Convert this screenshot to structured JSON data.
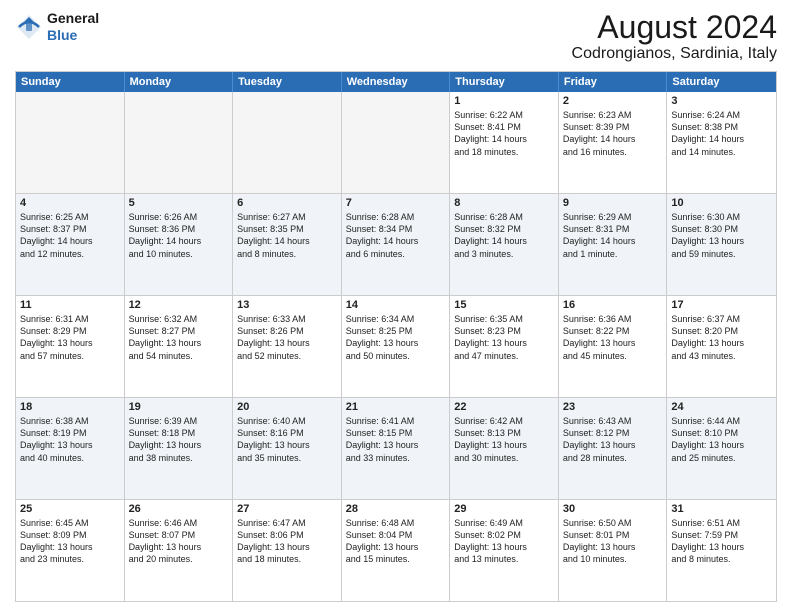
{
  "logo": {
    "line1": "General",
    "line2": "Blue"
  },
  "title": "August 2024",
  "subtitle": "Codrongianos, Sardinia, Italy",
  "days": [
    "Sunday",
    "Monday",
    "Tuesday",
    "Wednesday",
    "Thursday",
    "Friday",
    "Saturday"
  ],
  "weeks": [
    [
      {
        "day": "",
        "text": "",
        "empty": true
      },
      {
        "day": "",
        "text": "",
        "empty": true
      },
      {
        "day": "",
        "text": "",
        "empty": true
      },
      {
        "day": "",
        "text": "",
        "empty": true
      },
      {
        "day": "1",
        "text": "Sunrise: 6:22 AM\nSunset: 8:41 PM\nDaylight: 14 hours\nand 18 minutes."
      },
      {
        "day": "2",
        "text": "Sunrise: 6:23 AM\nSunset: 8:39 PM\nDaylight: 14 hours\nand 16 minutes."
      },
      {
        "day": "3",
        "text": "Sunrise: 6:24 AM\nSunset: 8:38 PM\nDaylight: 14 hours\nand 14 minutes."
      }
    ],
    [
      {
        "day": "4",
        "text": "Sunrise: 6:25 AM\nSunset: 8:37 PM\nDaylight: 14 hours\nand 12 minutes."
      },
      {
        "day": "5",
        "text": "Sunrise: 6:26 AM\nSunset: 8:36 PM\nDaylight: 14 hours\nand 10 minutes."
      },
      {
        "day": "6",
        "text": "Sunrise: 6:27 AM\nSunset: 8:35 PM\nDaylight: 14 hours\nand 8 minutes."
      },
      {
        "day": "7",
        "text": "Sunrise: 6:28 AM\nSunset: 8:34 PM\nDaylight: 14 hours\nand 6 minutes."
      },
      {
        "day": "8",
        "text": "Sunrise: 6:28 AM\nSunset: 8:32 PM\nDaylight: 14 hours\nand 3 minutes."
      },
      {
        "day": "9",
        "text": "Sunrise: 6:29 AM\nSunset: 8:31 PM\nDaylight: 14 hours\nand 1 minute."
      },
      {
        "day": "10",
        "text": "Sunrise: 6:30 AM\nSunset: 8:30 PM\nDaylight: 13 hours\nand 59 minutes."
      }
    ],
    [
      {
        "day": "11",
        "text": "Sunrise: 6:31 AM\nSunset: 8:29 PM\nDaylight: 13 hours\nand 57 minutes."
      },
      {
        "day": "12",
        "text": "Sunrise: 6:32 AM\nSunset: 8:27 PM\nDaylight: 13 hours\nand 54 minutes."
      },
      {
        "day": "13",
        "text": "Sunrise: 6:33 AM\nSunset: 8:26 PM\nDaylight: 13 hours\nand 52 minutes."
      },
      {
        "day": "14",
        "text": "Sunrise: 6:34 AM\nSunset: 8:25 PM\nDaylight: 13 hours\nand 50 minutes."
      },
      {
        "day": "15",
        "text": "Sunrise: 6:35 AM\nSunset: 8:23 PM\nDaylight: 13 hours\nand 47 minutes."
      },
      {
        "day": "16",
        "text": "Sunrise: 6:36 AM\nSunset: 8:22 PM\nDaylight: 13 hours\nand 45 minutes."
      },
      {
        "day": "17",
        "text": "Sunrise: 6:37 AM\nSunset: 8:20 PM\nDaylight: 13 hours\nand 43 minutes."
      }
    ],
    [
      {
        "day": "18",
        "text": "Sunrise: 6:38 AM\nSunset: 8:19 PM\nDaylight: 13 hours\nand 40 minutes."
      },
      {
        "day": "19",
        "text": "Sunrise: 6:39 AM\nSunset: 8:18 PM\nDaylight: 13 hours\nand 38 minutes."
      },
      {
        "day": "20",
        "text": "Sunrise: 6:40 AM\nSunset: 8:16 PM\nDaylight: 13 hours\nand 35 minutes."
      },
      {
        "day": "21",
        "text": "Sunrise: 6:41 AM\nSunset: 8:15 PM\nDaylight: 13 hours\nand 33 minutes."
      },
      {
        "day": "22",
        "text": "Sunrise: 6:42 AM\nSunset: 8:13 PM\nDaylight: 13 hours\nand 30 minutes."
      },
      {
        "day": "23",
        "text": "Sunrise: 6:43 AM\nSunset: 8:12 PM\nDaylight: 13 hours\nand 28 minutes."
      },
      {
        "day": "24",
        "text": "Sunrise: 6:44 AM\nSunset: 8:10 PM\nDaylight: 13 hours\nand 25 minutes."
      }
    ],
    [
      {
        "day": "25",
        "text": "Sunrise: 6:45 AM\nSunset: 8:09 PM\nDaylight: 13 hours\nand 23 minutes."
      },
      {
        "day": "26",
        "text": "Sunrise: 6:46 AM\nSunset: 8:07 PM\nDaylight: 13 hours\nand 20 minutes."
      },
      {
        "day": "27",
        "text": "Sunrise: 6:47 AM\nSunset: 8:06 PM\nDaylight: 13 hours\nand 18 minutes."
      },
      {
        "day": "28",
        "text": "Sunrise: 6:48 AM\nSunset: 8:04 PM\nDaylight: 13 hours\nand 15 minutes."
      },
      {
        "day": "29",
        "text": "Sunrise: 6:49 AM\nSunset: 8:02 PM\nDaylight: 13 hours\nand 13 minutes."
      },
      {
        "day": "30",
        "text": "Sunrise: 6:50 AM\nSunset: 8:01 PM\nDaylight: 13 hours\nand 10 minutes."
      },
      {
        "day": "31",
        "text": "Sunrise: 6:51 AM\nSunset: 7:59 PM\nDaylight: 13 hours\nand 8 minutes."
      }
    ]
  ]
}
